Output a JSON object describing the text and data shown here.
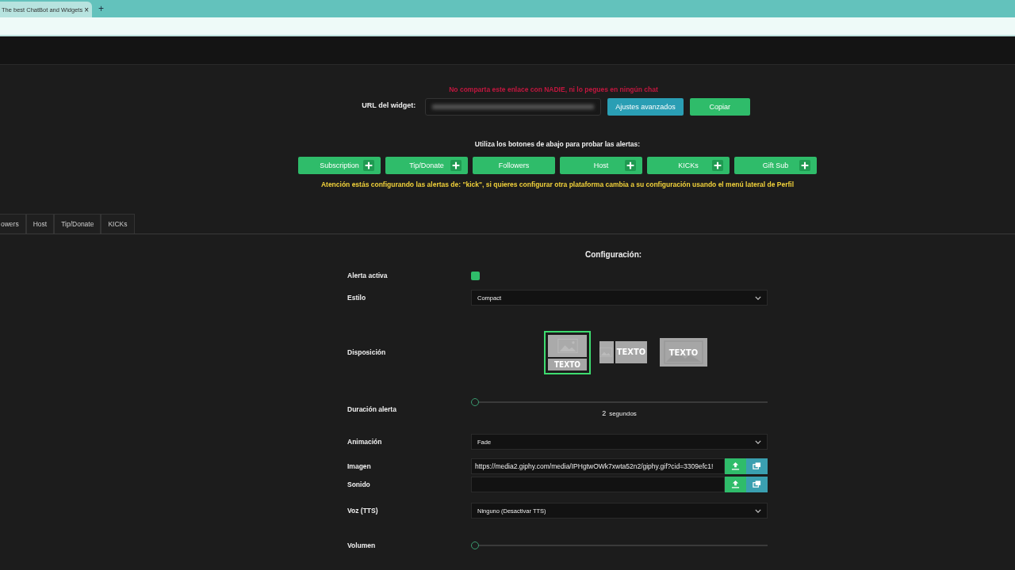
{
  "browser": {
    "tab_title": "The best ChatBot and Widgets",
    "close": "×",
    "new_tab": "+"
  },
  "widget": {
    "warning": "No comparta este enlace con NADIE, ni lo pegues en ningún chat",
    "url_label": "URL del widget:",
    "buttons": [
      {
        "label": "Ajustes avanzados",
        "kind": "info"
      },
      {
        "label": "Copiar",
        "kind": "success"
      }
    ]
  },
  "test": {
    "title": "Utiliza los botones de abajo para probar las alertas:",
    "buttons": [
      {
        "label": "Subscription",
        "plus": true
      },
      {
        "label": "Tip/Donate",
        "plus": true
      },
      {
        "label": "Followers",
        "plus": false
      },
      {
        "label": "Host",
        "plus": true
      },
      {
        "label": "KICKs",
        "plus": true
      },
      {
        "label": "Gift Sub",
        "plus": true
      }
    ],
    "notice": "Atención estás configurando las alertas de: \"kick\", si quieres configurar otra plataforma cambia a su configuración usando el menú lateral de Perfil"
  },
  "tabs": [
    "owers",
    "Host",
    "Tip/Donate",
    "KICKs"
  ],
  "config": {
    "title": "Configuración:",
    "rows": [
      {
        "kind": "checkbox",
        "label": "Alerta activa",
        "checked": true
      },
      {
        "kind": "select",
        "label": "Estilo",
        "value": "Compact"
      },
      {
        "kind": "layout",
        "label": "Disposición",
        "options": [
          {
            "kind": "stacked",
            "text": "TEXTO",
            "selected": true
          },
          {
            "kind": "side",
            "text": "TEXTO",
            "selected": false
          },
          {
            "kind": "overlay",
            "text": "TEXTO",
            "selected": false
          }
        ]
      },
      {
        "kind": "slider",
        "label": "Duración alerta",
        "level": 0,
        "number": "2",
        "unit": "segundos"
      },
      {
        "kind": "select",
        "label": "Animación",
        "value": "Fade"
      },
      {
        "kind": "file",
        "label": "Imagen",
        "value": "https://media2.giphy.com/media/IPHgtwOWk7xwta52n2/giphy.gif?cid=3309efc1!"
      },
      {
        "kind": "file",
        "label": "Sonido",
        "value": ""
      },
      {
        "kind": "select",
        "label": "Voz (TTS)",
        "value": "Ninguno (Desactivar TTS)"
      },
      {
        "kind": "slider",
        "label": "Volumen",
        "level": 0
      }
    ]
  }
}
